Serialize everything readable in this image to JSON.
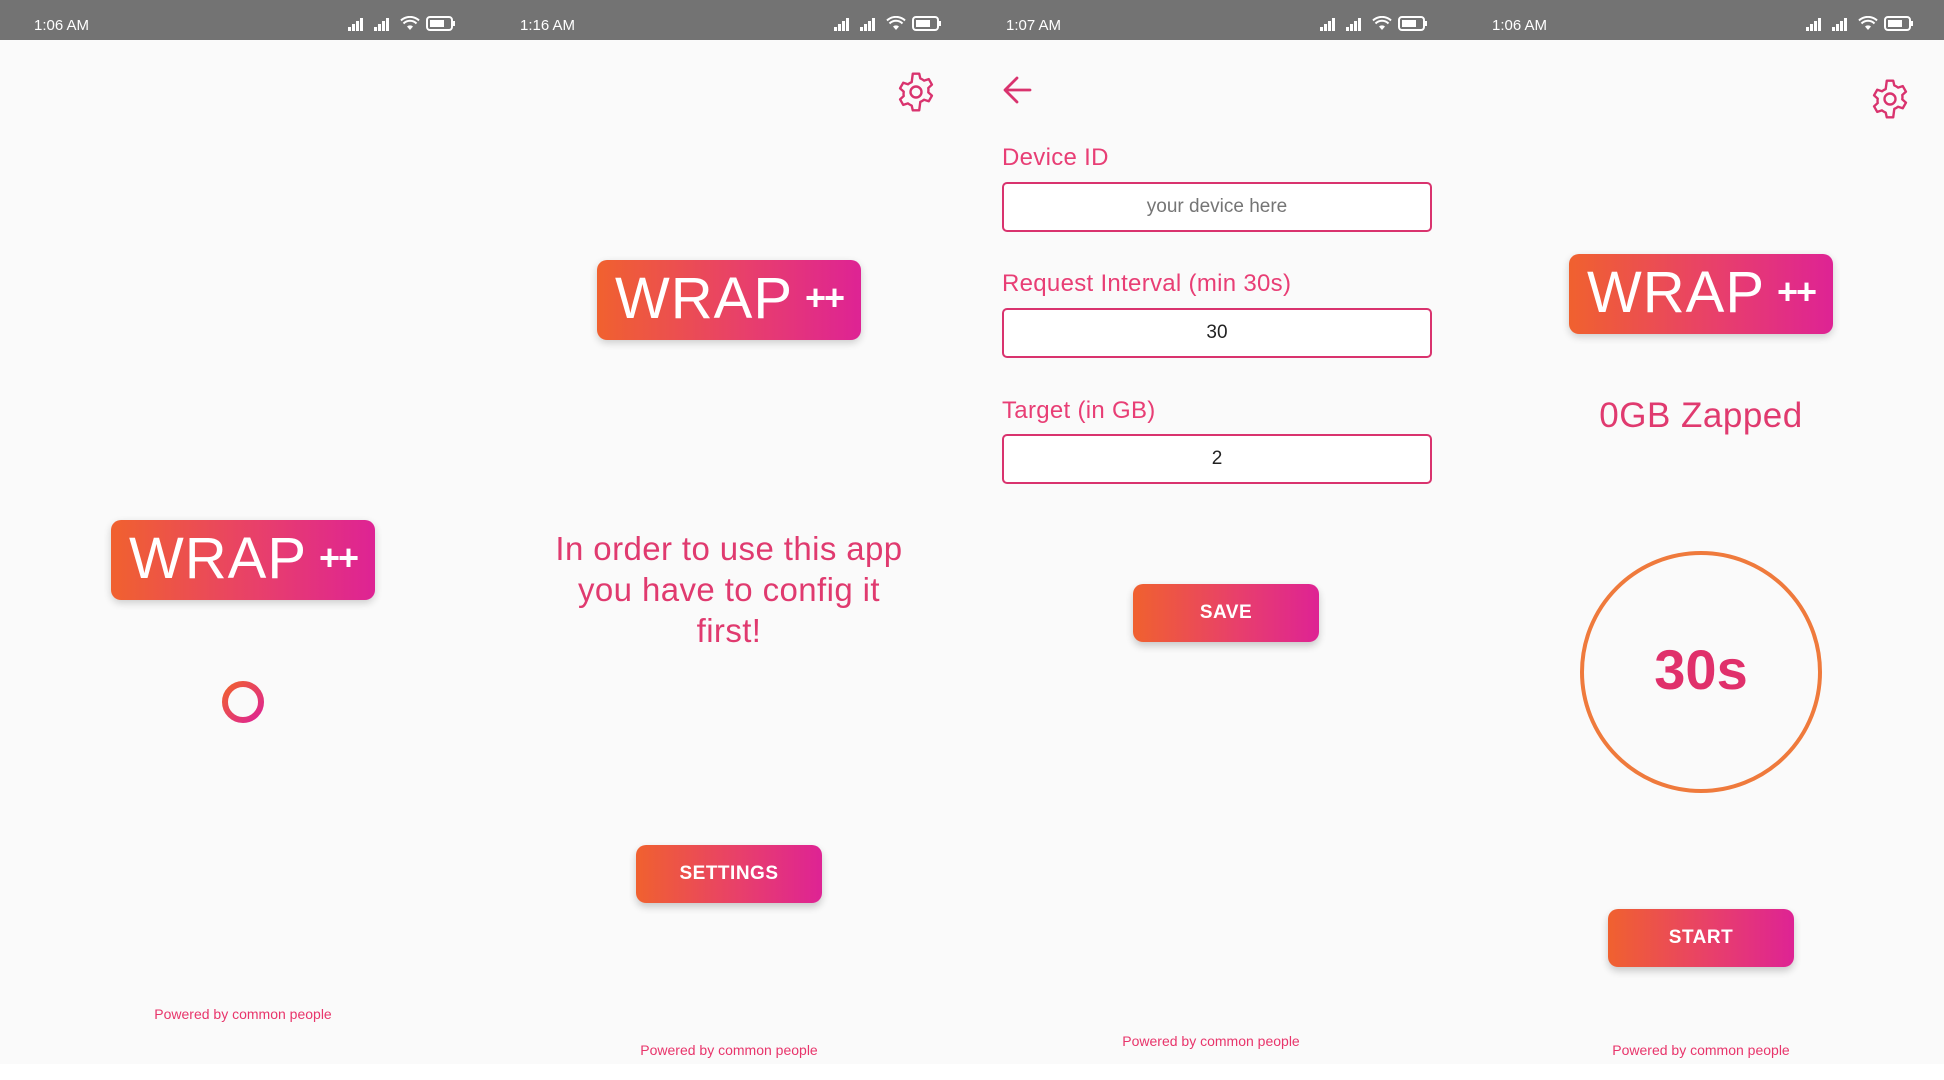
{
  "colors": {
    "accent_pink": "#e0306b",
    "gradient_start": "#f0612f",
    "gradient_end": "#de2394",
    "status_bar": "#737373",
    "background": "#fafafa"
  },
  "logo": {
    "text": "WRAP",
    "plus": "++"
  },
  "footer": "Powered by common people",
  "screens": [
    {
      "status_time": "1:06 AM",
      "loading_indicator": "loading-spinner"
    },
    {
      "status_time": "1:16 AM",
      "message": "In order to use this app you have to config it first!",
      "button_label": "SETTINGS"
    },
    {
      "status_time": "1:07 AM",
      "fields": [
        {
          "label": "Device ID",
          "placeholder": "your device here",
          "value": ""
        },
        {
          "label": "Request Interval (min 30s)",
          "placeholder": "",
          "value": "30"
        },
        {
          "label": "Target (in GB)",
          "placeholder": "",
          "value": "2"
        }
      ],
      "button_label": "SAVE"
    },
    {
      "status_time": "1:06 AM",
      "zapped_text": "0GB Zapped",
      "timer_text": "30s",
      "button_label": "START"
    }
  ],
  "icons": {
    "signal": "signal-icon",
    "wifi": "wifi-icon",
    "battery": "battery-icon",
    "settings": "gear-icon",
    "back": "back-arrow-icon"
  }
}
